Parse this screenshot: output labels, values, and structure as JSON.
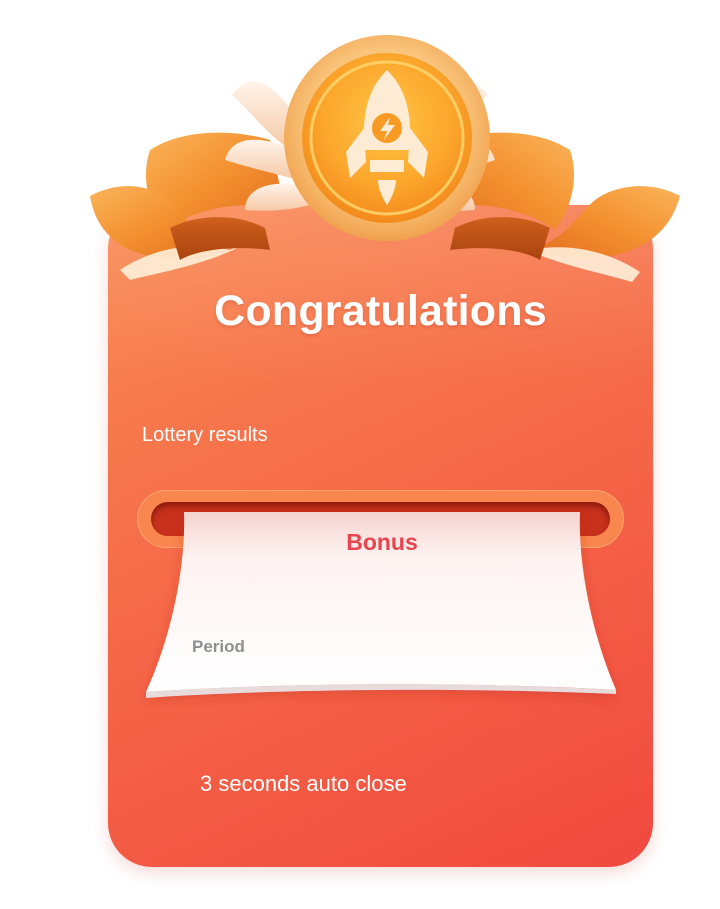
{
  "dialog": {
    "title": "Congratulations",
    "lottery_label": "Lottery results",
    "ticket": {
      "heading": "Bonus",
      "period_label": "Period"
    },
    "auto_close_text": "3 seconds auto close"
  },
  "icons": {
    "badge": "rocket-icon",
    "badge_inner": "lightning-icon"
  },
  "colors": {
    "card_top": "#f98a52",
    "card_bottom": "#f1493f",
    "ribbon": "#f39a35",
    "medal": "#fbb437",
    "bonus_text": "#e8454e",
    "period_text": "#8f8f8f"
  }
}
